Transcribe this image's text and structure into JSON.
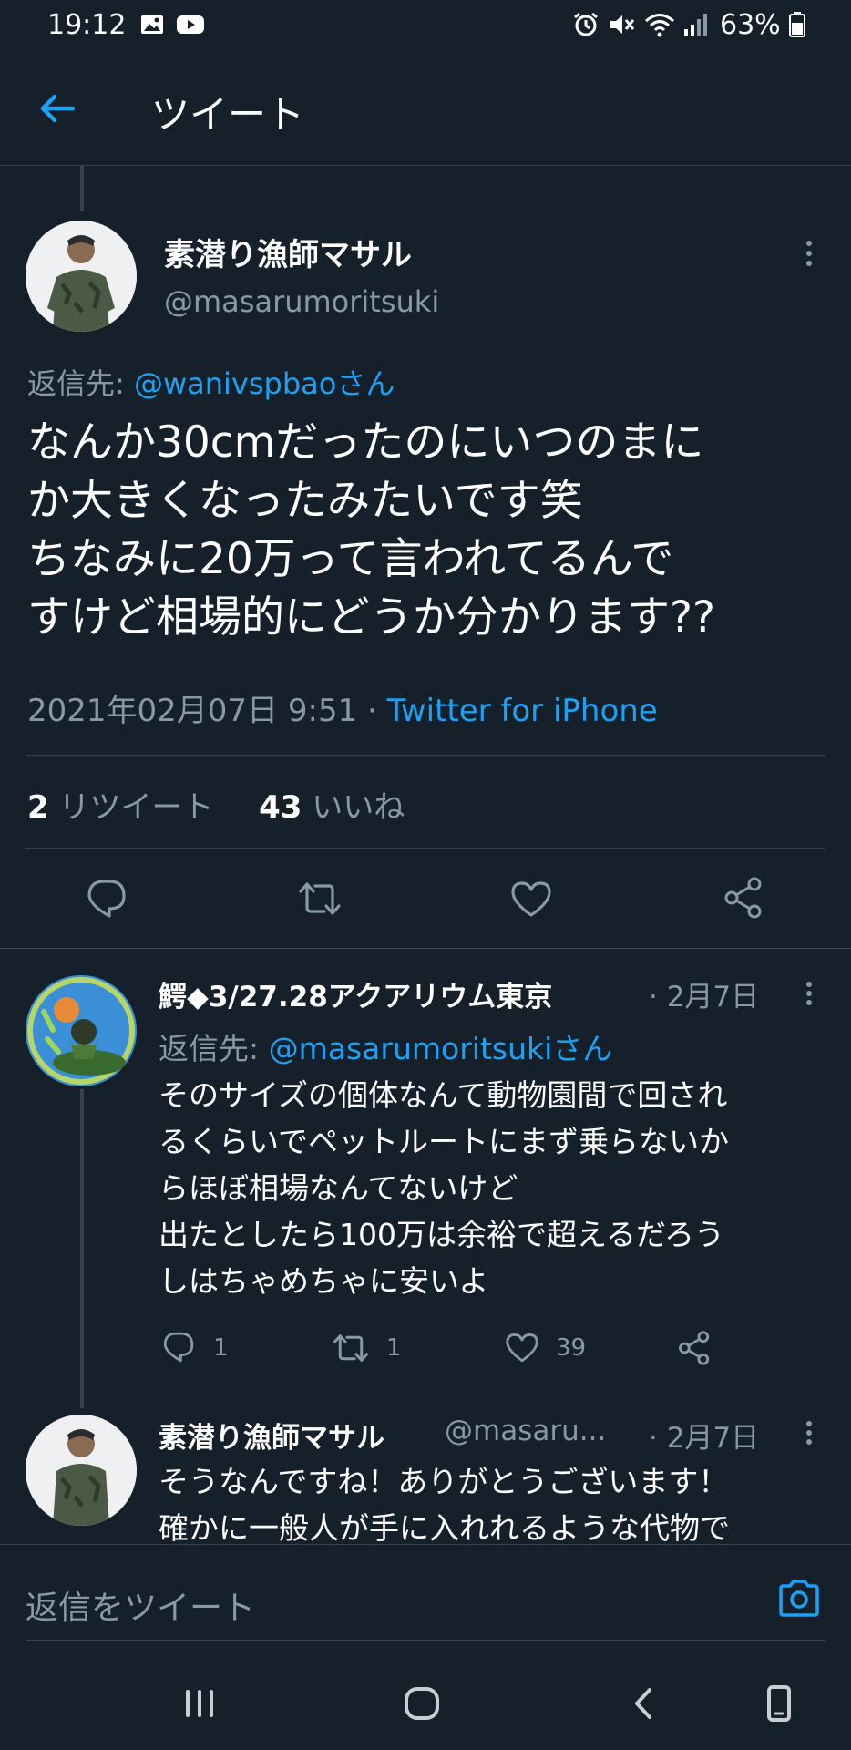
{
  "status_bar": {
    "time": "19:12",
    "battery": "63%"
  },
  "header": {
    "title": "ツイート"
  },
  "tweet": {
    "author_name": "素潜り漁師マサル",
    "author_handle": "@masarumoritsuki",
    "reply_prefix": "返信先: ",
    "reply_mention": "@wanivspbaoさん",
    "text_lines": [
      "なんか30cmだったのにいつのまに",
      "か大きくなったみたいです笑",
      "ちなみに20万って言われてるんで",
      "すけど相場的にどうか分かります??"
    ],
    "timestamp": "2021年02月07日 9:51 · ",
    "source": "Twitter for iPhone",
    "retweet_count": "2",
    "retweet_label": " リツイート",
    "like_count": "43",
    "like_label": " いいね"
  },
  "replies": [
    {
      "author_name": "鰐◆3/27.28アクアリウム東京",
      "date": "· 2月7日",
      "reply_prefix": "返信先: ",
      "reply_mention": "@masarumoritsukiさん",
      "text_lines": [
        "そのサイズの個体なんて動物園間で回され",
        "るくらいでペットルートにまず乗らないか",
        "らほぼ相場なんてないけど",
        "出たとしたら100万は余裕で超えるだろう",
        "しはちゃめちゃに安いよ"
      ],
      "reply_count": "1",
      "retweet_count": "1",
      "like_count": "39"
    },
    {
      "author_name": "素潜り漁師マサル",
      "author_handle": "@masaru...",
      "date": "· 2月7日",
      "text_lines": [
        "そうなんですね！ありがとうございます！",
        "確かに一般人が手に入れれるような代物で"
      ]
    }
  ],
  "compose": {
    "placeholder": "返信をツイート"
  },
  "colors": {
    "background": "#15202b",
    "accent": "#1da1f2",
    "secondary_text": "#8899a6",
    "divider": "#38444d"
  }
}
